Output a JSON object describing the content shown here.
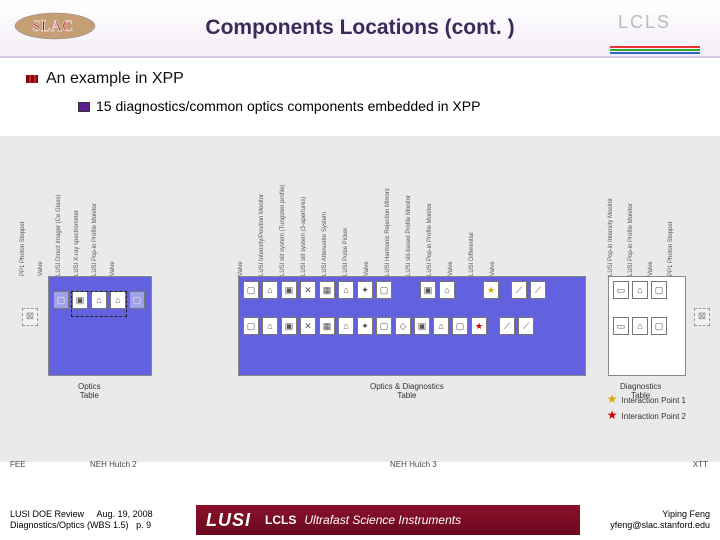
{
  "title": "Components Locations (cont. )",
  "bullets": {
    "main": "An example in XPP",
    "sub": "15 diagnostics/common optics components embedded in XPP"
  },
  "diagram": {
    "toplabels_left": [
      "PP1 Photon Stopper",
      "Valve",
      "LUSI Direct Imager (Ce Glass)",
      "LUSI X-ray spectrometer",
      "LUSI Pop-in Profile Monitor",
      "Valve"
    ],
    "toplabels_mid": [
      "Valve",
      "LUSI Intensity/Position Monitor",
      "LUSI slit system (Tungsten profile)",
      "LUSI slit system (3-apertures)",
      "LUSI Attenuator System",
      "LUSI Pulse Picker",
      "Valve",
      "LUSI Harmonic Rejection Mirrors",
      "LUSI slit-based Profile Monitor",
      "LUSI Pop-in Profile Monitor",
      "Valve",
      "LUSI Differential",
      "Valve"
    ],
    "toplabels_right": [
      "LUSI Pop-in Intensity Monitor",
      "LUSI Pop-in Profile Monitor",
      "Valve",
      "PP1 Photon Stopper"
    ],
    "table1": "Optics\nTable",
    "table2": "Optics & Diagnostics\nTable",
    "table3": "Diagnostics\nTable",
    "interaction1": "Interaction Point 1",
    "interaction2": "Interaction Point 2",
    "axis_fee": "FEE",
    "axis_neh2": "NEH Hutch 2",
    "axis_neh3": "NEH Hutch 3",
    "axis_xtt": "XTT"
  },
  "footer": {
    "review": "LUSI DOE Review",
    "date": "Aug. 19, 2008",
    "wbs": "Diagnostics/Optics (WBS 1.5)",
    "page": "p. 9",
    "banner_lusi": "LUSI",
    "banner_lcls": "LCLS",
    "banner_text": "Ultrafast Science Instruments",
    "author": "Yiping Feng",
    "email": "yfeng@slac.stanford.edu"
  },
  "logos": {
    "slac": "SLAC",
    "lcls": "LCLS"
  }
}
